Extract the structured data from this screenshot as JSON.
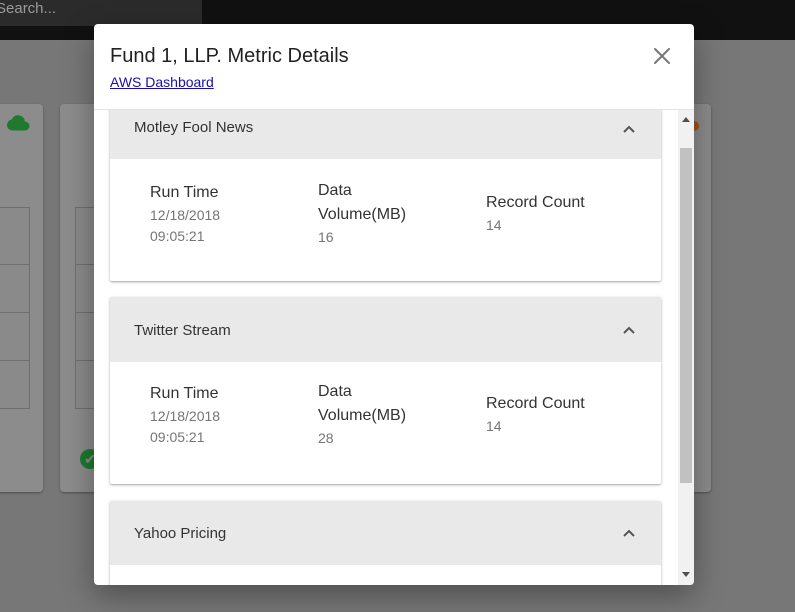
{
  "background": {
    "search_placeholder": "Search..."
  },
  "modal": {
    "title": "Fund 1, LLP. Metric Details",
    "link": "AWS Dashboard",
    "panels": [
      {
        "title": "Motley Fool News",
        "expanded": true,
        "run_time_label": "Run Time",
        "run_time_date": "12/18/2018",
        "run_time_time": "09:05:21",
        "data_volume_label_1": "Data",
        "data_volume_label_2": "Volume(MB)",
        "data_volume_value": "16",
        "record_count_label": "Record Count",
        "record_count_value": "14"
      },
      {
        "title": "Twitter Stream",
        "expanded": true,
        "run_time_label": "Run Time",
        "run_time_date": "12/18/2018",
        "run_time_time": "09:05:21",
        "data_volume_label_1": "Data",
        "data_volume_label_2": "Volume(MB)",
        "data_volume_value": "28",
        "record_count_label": "Record Count",
        "record_count_value": "14"
      },
      {
        "title": "Yahoo Pricing",
        "expanded": true
      }
    ]
  },
  "colors": {
    "overlay": "#777777",
    "panel_header": "#e9e9e9",
    "link": "#1a0dab",
    "label": "#333333",
    "value": "#757575"
  },
  "icons": {
    "close": "close-icon",
    "chevron": "chevron-up-icon",
    "cloud": "cloud-icon",
    "check": "check-circle-icon"
  }
}
